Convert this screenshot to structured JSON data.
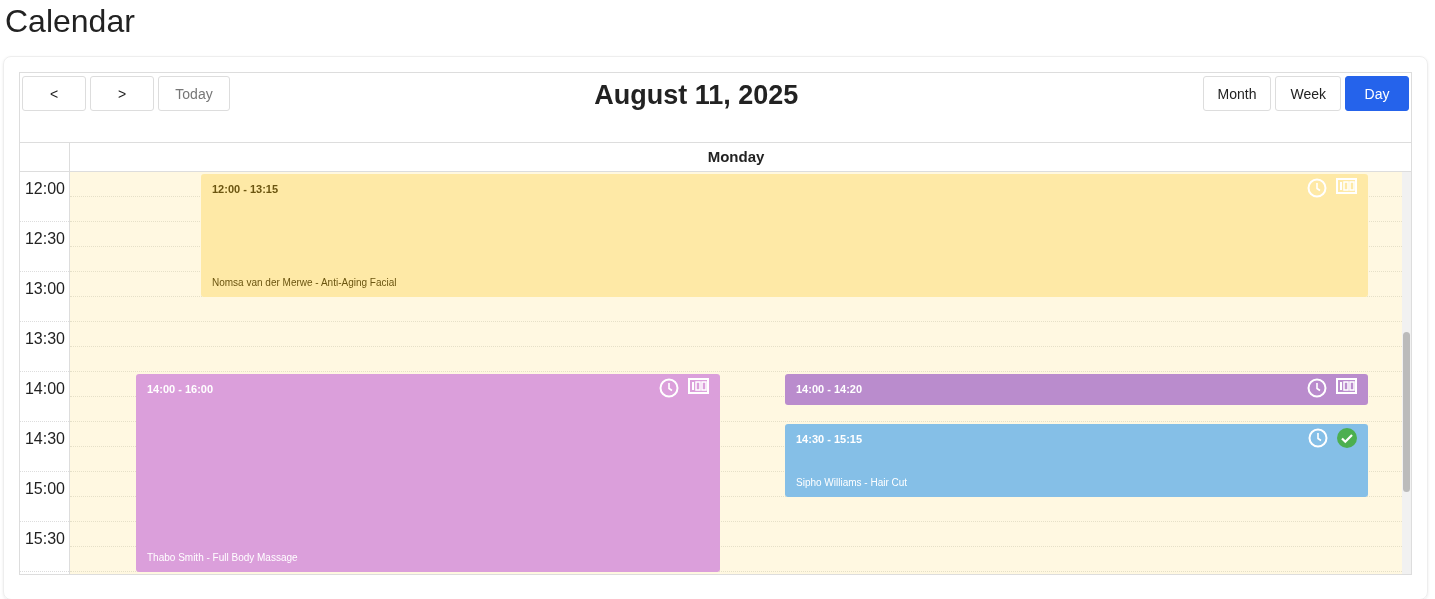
{
  "page_title": "Calendar",
  "toolbar": {
    "prev": "<",
    "next": ">",
    "today": "Today",
    "title": "August 11, 2025",
    "views": [
      {
        "label": "Month",
        "selected": false
      },
      {
        "label": "Week",
        "selected": false
      },
      {
        "label": "Day",
        "selected": true
      }
    ]
  },
  "day_header": "Monday",
  "times": [
    "12:00",
    "12:30",
    "13:00",
    "13:30",
    "14:00",
    "14:30",
    "15:00",
    "15:30"
  ],
  "events": [
    {
      "time": "12:00 - 13:15",
      "title": "Nomsa van der Merwe - Anti-Aging Facial",
      "color": "#fee9a6",
      "confirmed": false
    },
    {
      "time": "14:00 - 16:00",
      "title": "Thabo Smith - Full Body Massage",
      "color": "#db9fdb",
      "confirmed": false
    },
    {
      "time": "14:00 - 14:20",
      "color": "#ba8ccd",
      "confirmed": false
    },
    {
      "time": "14:30 - 15:15",
      "title": "Sipho Williams - Hair Cut",
      "color": "#85bfe7",
      "confirmed": true
    }
  ]
}
